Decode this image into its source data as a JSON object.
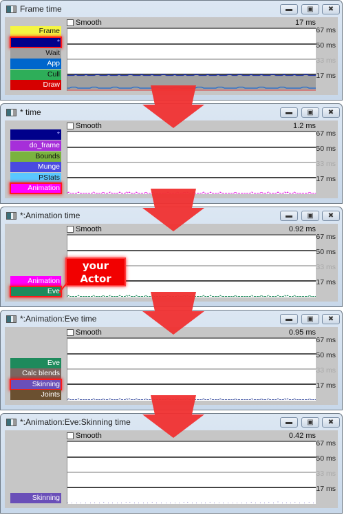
{
  "smooth_label": "Smooth",
  "tick_labels": [
    "67 ms",
    "50 ms",
    "33 ms",
    "17 ms"
  ],
  "windows": [
    {
      "title": "Frame time",
      "scale": "17 ms",
      "labels": [
        {
          "text": "Frame",
          "bg": "#f5f542",
          "fg": "#111111",
          "highlight": false
        },
        {
          "text": "*",
          "bg": "#00008b",
          "fg": "#aaaaff",
          "highlight": true
        },
        {
          "text": "Wait",
          "bg": "#a0a0a0",
          "fg": "#111111",
          "highlight": false
        },
        {
          "text": "App",
          "bg": "#0066cc",
          "fg": "#ffffff",
          "highlight": false
        },
        {
          "text": "Cull",
          "bg": "#2eae59",
          "fg": "#111111",
          "highlight": false
        },
        {
          "text": "Draw",
          "bg": "#d60000",
          "fg": "#ffffff",
          "highlight": false
        }
      ],
      "trace_color": "#1c2fa8",
      "fill_color": "#a0a0a0"
    },
    {
      "title": "* time",
      "scale": "1.2 ms",
      "labels": [
        {
          "text": "*",
          "bg": "#00008b",
          "fg": "#aaaaff",
          "highlight": false
        },
        {
          "text": "do_frame",
          "bg": "#a62fd9",
          "fg": "#ffffff",
          "highlight": false
        },
        {
          "text": "Bounds",
          "bg": "#7ab33f",
          "fg": "#111111",
          "highlight": false
        },
        {
          "text": "Munge",
          "bg": "#4a4ae0",
          "fg": "#ffffff",
          "highlight": false
        },
        {
          "text": "PStats",
          "bg": "#5ac8ff",
          "fg": "#111111",
          "highlight": false
        },
        {
          "text": "Animation",
          "bg": "#ff00ff",
          "fg": "#ffffff",
          "highlight": true
        }
      ],
      "trace_color": "#e000e0"
    },
    {
      "title": "*:Animation time",
      "scale": "0.92 ms",
      "labels": [
        {
          "text": "Animation",
          "bg": "#ff00ff",
          "fg": "#ffffff",
          "highlight": false
        },
        {
          "text": "Eve",
          "bg": "#1e8a5c",
          "fg": "#ffffff",
          "highlight": true
        }
      ],
      "trace_color": "#1e8a5c"
    },
    {
      "title": "*:Animation:Eve time",
      "scale": "0.95 ms",
      "labels": [
        {
          "text": "Eve",
          "bg": "#1e8a5c",
          "fg": "#ffffff",
          "highlight": false
        },
        {
          "text": "Calc blends",
          "bg": "#7a6660",
          "fg": "#ffffff",
          "highlight": false
        },
        {
          "text": "Skinning",
          "bg": "#6a4fb8",
          "fg": "#ffffff",
          "highlight": true
        },
        {
          "text": "Joints",
          "bg": "#6b5030",
          "fg": "#ffffff",
          "highlight": false
        }
      ],
      "trace_color": "#3a4ea0"
    },
    {
      "title": "*:Animation:Eve:Skinning time",
      "scale": "0.42 ms",
      "labels": [
        {
          "text": "Skinning",
          "bg": "#6a4fb8",
          "fg": "#ffffff",
          "highlight": false
        }
      ],
      "trace_color": "#8a80c8"
    }
  ],
  "callout": {
    "line1": "your",
    "line2": "Actor"
  },
  "colors": {
    "arrow": "#f03030",
    "highlight": "#ff1a1a"
  }
}
